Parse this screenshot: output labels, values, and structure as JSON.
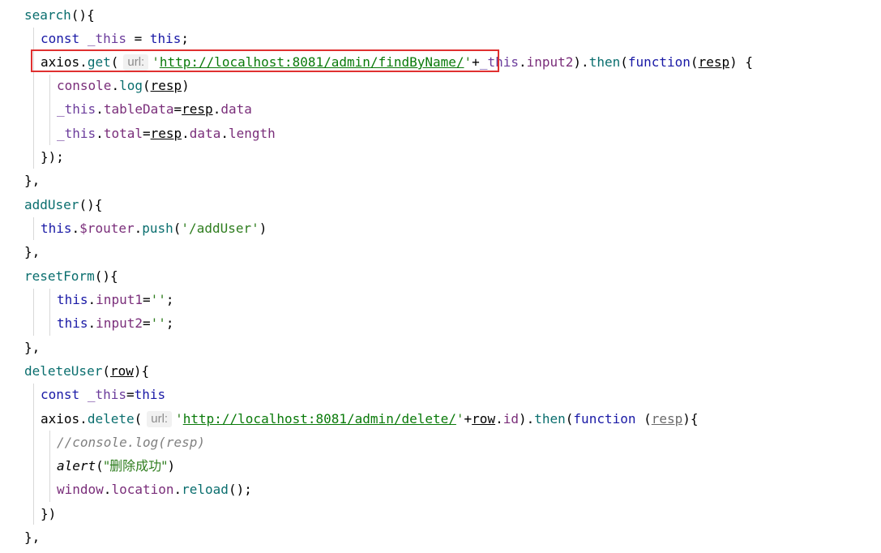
{
  "code": {
    "search": {
      "name": "search",
      "open": "(){"
    },
    "search_const": {
      "kw": "const",
      "var": "_this",
      "eq": " = ",
      "this": "this",
      "semi": ";"
    },
    "search_axios": {
      "obj": "axios",
      "dot": ".",
      "method": "get",
      "open": "(",
      "hint": "url:",
      "url_quote_open": "'",
      "url": "http://localhost:8081/admin/findByName/",
      "url_quote_close": "'",
      "plus": "+",
      "this_var": "_this",
      "dot2": ".",
      "prop": "input2",
      "close": ").",
      "then": "then",
      "open2": "(",
      "function": "function",
      "open3": "(",
      "param": "resp",
      "close2": ") {"
    },
    "search_log": {
      "console": "console",
      "dot": ".",
      "log": "log",
      "open": "(",
      "param": "resp",
      "close": ")"
    },
    "search_tabledata": {
      "var": "_this",
      "dot": ".",
      "prop": "tableData",
      "eq": "=",
      "param": "resp",
      "dot2": ".",
      "prop2": "data"
    },
    "search_total": {
      "var": "_this",
      "dot": ".",
      "prop": "total",
      "eq": "=",
      "param": "resp",
      "dot2": ".",
      "prop2": "data",
      "dot3": ".",
      "prop3": "length"
    },
    "search_close_then": "});",
    "search_close": "},",
    "adduser": {
      "name": "addUser",
      "open": "(){"
    },
    "adduser_push": {
      "this": "this",
      "dot": ".",
      "router": "$router",
      "dot2": ".",
      "push": "push",
      "open": "(",
      "str": "'/addUser'",
      "close": ")"
    },
    "adduser_close": "},",
    "resetform": {
      "name": "resetForm",
      "open": "(){"
    },
    "reset_input1": {
      "this": "this",
      "dot": ".",
      "prop": "input1",
      "eq": "=",
      "str": "''",
      "semi": ";"
    },
    "reset_input2": {
      "this": "this",
      "dot": ".",
      "prop": "input2",
      "eq": "=",
      "str": "''",
      "semi": ";"
    },
    "resetform_close": "},",
    "deleteuser": {
      "name": "deleteUser",
      "open": "(",
      "param": "row",
      "close": "){"
    },
    "delete_const": {
      "kw": "const",
      "var": "_this",
      "eq": "=",
      "this": "this"
    },
    "delete_axios": {
      "obj": "axios",
      "dot": ".",
      "method": "delete",
      "open": "(",
      "hint": "url:",
      "url_quote_open": "'",
      "url": "http://localhost:8081/admin/delete/",
      "url_quote_close": "'",
      "plus": "+",
      "param": "row",
      "dot2": ".",
      "prop": "id",
      "close": ").",
      "then": "then",
      "open2": "(",
      "function": "function",
      "space": " ",
      "open3": "(",
      "param2": "resp",
      "close2": "){"
    },
    "delete_comment": "//console.log(resp)",
    "delete_alert": {
      "fn": "alert",
      "open": "(",
      "str": "\"删除成功\"",
      "close": ")"
    },
    "delete_reload": {
      "window": "window",
      "dot": ".",
      "location": "location",
      "dot2": ".",
      "reload": "reload",
      "close": "();"
    },
    "delete_close_then": "})",
    "delete_close": "},"
  },
  "colors": {
    "highlight_border": "#e03030",
    "string": "#2e7d1e",
    "keyword": "#1a1aa6",
    "property": "#7a2e7a",
    "comment": "#808080"
  }
}
